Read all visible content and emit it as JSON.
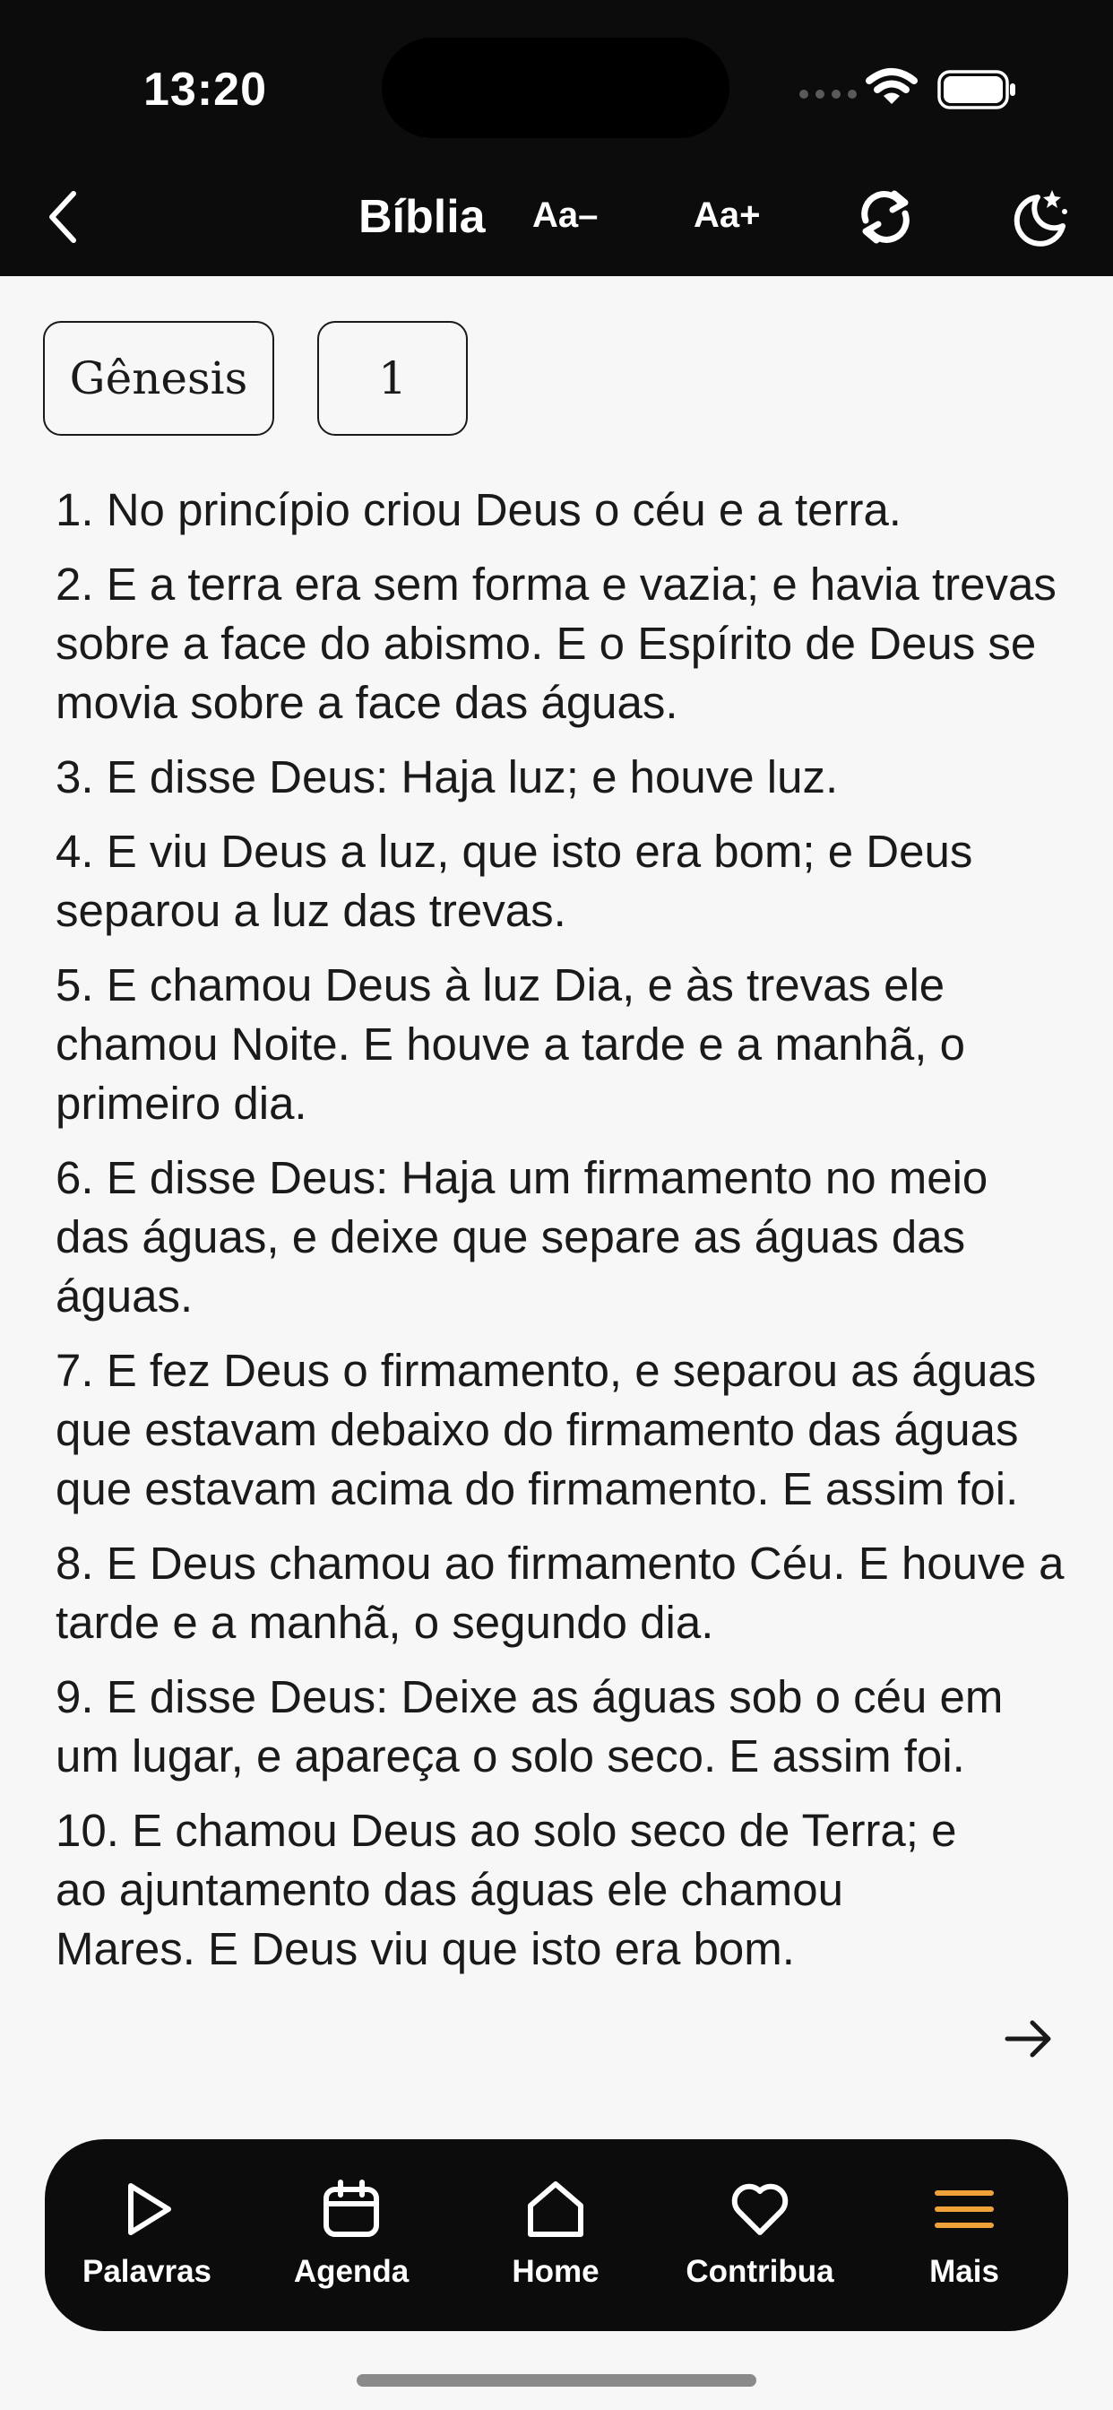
{
  "status_bar": {
    "time": "13:20"
  },
  "nav": {
    "title": "Bíblia",
    "font_decrease": "Aa–",
    "font_increase": "Aa+",
    "icons": [
      "chevron-left-icon",
      "sync-icon",
      "moon-stars-icon"
    ]
  },
  "selectors": {
    "book": "Gênesis",
    "chapter": "1"
  },
  "verses": [
    "1. No princípio criou Deus o céu e a terra.",
    "2. E a terra era sem forma e vazia; e havia trevas sobre a face do abismo. E o Espírito de Deus se movia sobre a face das águas.",
    "3. E disse Deus: Haja luz; e houve luz.",
    "4. E viu Deus a luz, que isto era bom; e Deus separou a luz das trevas.",
    "5. E chamou Deus à luz Dia, e às trevas ele chamou Noite. E houve a tarde e a manhã, o primeiro dia.",
    "6. E disse Deus: Haja um firmamento no meio das águas, e deixe que separe as águas das águas.",
    "7. E fez Deus o firmamento, e separou as águas que estavam debaixo do firmamento das águas que estavam acima do firmamento. E assim foi.",
    "8. E Deus chamou ao firmamento Céu. E houve a tarde e a manhã, o segundo dia.",
    "9. E disse Deus: Deixe as águas sob o céu em um lugar, e apareça o solo seco. E assim foi.",
    "10. E chamou Deus ao solo seco de Terra; e ao ajuntamento das águas ele chamou Mares. E Deus viu que isto era bom."
  ],
  "tabs": [
    {
      "label": "Palavras",
      "icon": "play-icon"
    },
    {
      "label": "Agenda",
      "icon": "calendar-icon"
    },
    {
      "label": "Home",
      "icon": "home-icon"
    },
    {
      "label": "Contribua",
      "icon": "heart-icon"
    },
    {
      "label": "Mais",
      "icon": "menu-icon"
    }
  ],
  "colors": {
    "bar_background": "#0c0c0c",
    "page_background": "#f7f7f7",
    "text": "#1a1a1a",
    "menu_accent": "#f0a23a"
  }
}
